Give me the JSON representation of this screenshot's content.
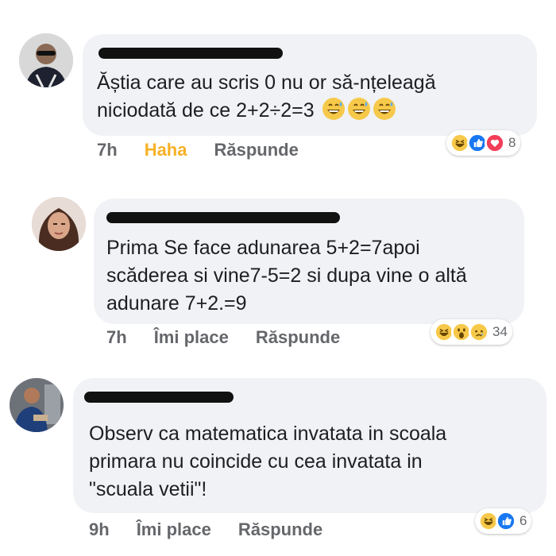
{
  "colors": {
    "bubble": "#f0f2f5",
    "meta_text": "#65676b",
    "haha_active": "#f7b125",
    "like_blue": "#1877f2",
    "love_red": "#f33e58",
    "emoji_yellow": "#f7c94a"
  },
  "comments": [
    {
      "lines": [
        "Ăștia care au scris 0 nu or să-nțeleagă",
        "niciodată de ce 2+2÷2=3"
      ],
      "inline_emojis": [
        "grinning-sweat-emoji",
        "grinning-sweat-emoji",
        "grinning-sweat-emoji"
      ],
      "time": "7h",
      "like_label": "Haha",
      "reply_label": "Răspunde",
      "reactions": [
        "haha",
        "like",
        "love"
      ],
      "reaction_count": "8"
    },
    {
      "lines": [
        "Prima Se face adunarea 5+2=7apoi",
        "scăderea si vine7-5=2 si dupa vine o altă",
        "adunare 7+2.=9"
      ],
      "time": "7h",
      "like_label": "Îmi place",
      "reply_label": "Răspunde",
      "reactions": [
        "haha",
        "wow",
        "sad"
      ],
      "reaction_count": "34"
    },
    {
      "lines": [
        "Observ ca matematica invatata in scoala",
        "primara nu coincide cu cea invatata in",
        "\"scuala vetii\"!"
      ],
      "time": "9h",
      "like_label": "Îmi place",
      "reply_label": "Răspunde",
      "reactions": [
        "haha",
        "like"
      ],
      "reaction_count": "6"
    }
  ]
}
